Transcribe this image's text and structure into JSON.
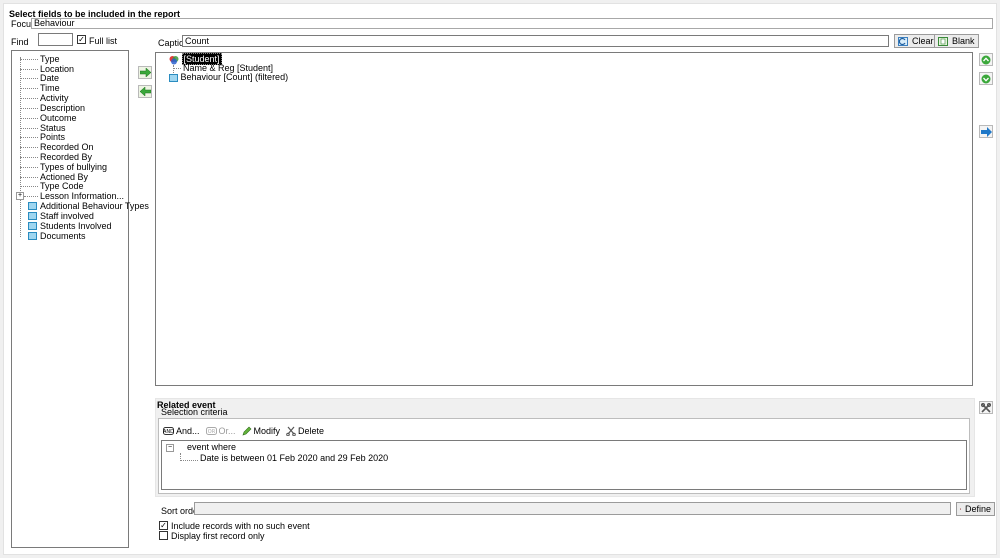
{
  "header": {
    "title": "Select fields to be included in the report",
    "focus_label": "Focus",
    "focus_value": "Behaviour"
  },
  "find": {
    "label": "Find",
    "value": "",
    "full_list_label": "Full list",
    "full_list_checked": true
  },
  "fields_tree": {
    "items": [
      {
        "label": "Type"
      },
      {
        "label": "Location"
      },
      {
        "label": "Date"
      },
      {
        "label": "Time"
      },
      {
        "label": "Activity"
      },
      {
        "label": "Description"
      },
      {
        "label": "Outcome"
      },
      {
        "label": "Status"
      },
      {
        "label": "Points"
      },
      {
        "label": "Recorded On"
      },
      {
        "label": "Recorded By"
      },
      {
        "label": "Types of bullying"
      },
      {
        "label": "Actioned By"
      },
      {
        "label": "Type Code"
      },
      {
        "label": "Lesson Information..."
      },
      {
        "label": "Additional Behaviour Types"
      },
      {
        "label": "Staff involved"
      },
      {
        "label": "Students Involved"
      },
      {
        "label": "Documents"
      }
    ]
  },
  "caption": {
    "label": "Caption",
    "value": "Count",
    "clear_label": "Clear",
    "blank_label": "Blank"
  },
  "selected_fields": {
    "root": "[Student]",
    "children": [
      "Name & Reg [Student]",
      "Behaviour [Count] (filtered)"
    ]
  },
  "related_event": {
    "title": "Related event",
    "selection_criteria_label": "Selection criteria",
    "toolbar": {
      "and_label": "And...",
      "or_label": "Or...",
      "modify_label": "Modify",
      "delete_label": "Delete"
    },
    "criteria_root": "event where",
    "criteria_child": "Date is between 01 Feb 2020 and 29 Feb 2020"
  },
  "sort": {
    "label": "Sort order",
    "value": "",
    "define_label": "Define"
  },
  "options": {
    "include_no_event_label": "Include records with no such event",
    "include_no_event_checked": true,
    "first_record_only_label": "Display first record only",
    "first_record_only_checked": false
  },
  "colors": {
    "window_bg": "#f0f0f0",
    "panel_bg": "#ffffff",
    "table_icon": "#9fd6f0",
    "arrow_green": "#3aa83a",
    "move_blue": "#1f78c8"
  }
}
